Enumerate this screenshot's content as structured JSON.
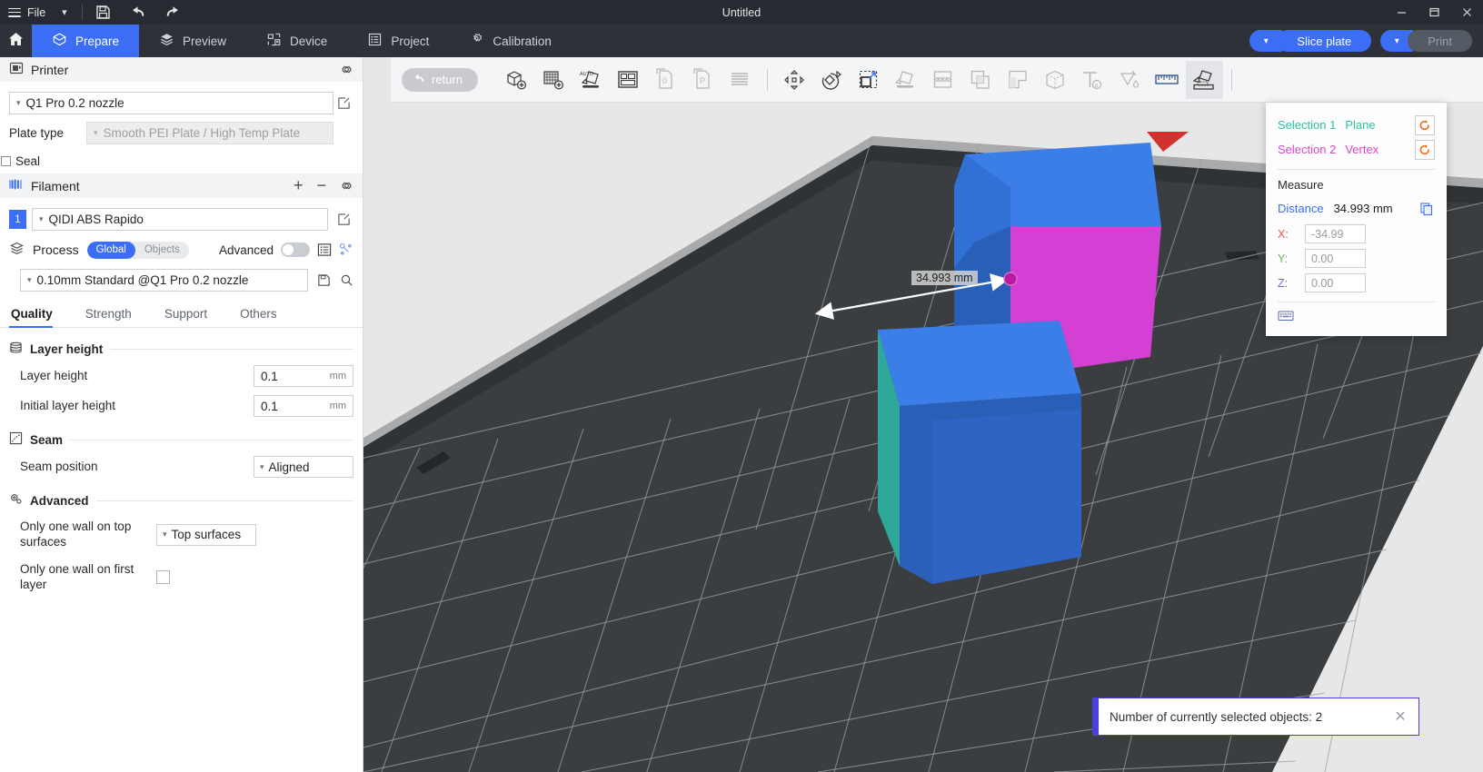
{
  "titlebar": {
    "menu_label": "File",
    "window_title": "Untitled",
    "icons": [
      "save-icon",
      "undo-icon",
      "redo-icon"
    ],
    "minimize": "–",
    "maximize": "❐",
    "close": "✕"
  },
  "nav": {
    "home_icon": "home-icon",
    "tabs": [
      {
        "label": "Prepare",
        "icon": "prepare-icon",
        "active": true
      },
      {
        "label": "Preview",
        "icon": "preview-icon",
        "active": false
      },
      {
        "label": "Device",
        "icon": "device-icon",
        "active": false
      },
      {
        "label": "Project",
        "icon": "project-icon",
        "active": false
      },
      {
        "label": "Calibration",
        "icon": "calibration-icon",
        "active": false
      }
    ],
    "slice_label": "Slice plate",
    "print_label": "Print"
  },
  "sidebar": {
    "printer": {
      "section_title": "Printer",
      "gear_icon": "gear-icon",
      "printer_value": "Q1 Pro 0.2 nozzle",
      "plate_type_label": "Plate type",
      "plate_type_value": "Smooth PEI Plate / High Temp Plate",
      "seal_label": "Seal",
      "seal_checked": false
    },
    "filament": {
      "section_title": "Filament",
      "add_label": "+",
      "remove_label": "−",
      "gear_icon": "gear-icon",
      "index": "1",
      "value": "QIDI ABS Rapido"
    },
    "process": {
      "section_title": "Process",
      "seg_global": "Global",
      "seg_objects": "Objects",
      "advanced_label": "Advanced",
      "advanced_on": false,
      "preset_value": "0.10mm Standard @Q1 Pro 0.2 nozzle",
      "tabs": [
        {
          "label": "Quality",
          "active": true
        },
        {
          "label": "Strength",
          "active": false
        },
        {
          "label": "Support",
          "active": false
        },
        {
          "label": "Others",
          "active": false
        }
      ],
      "groups": [
        {
          "title": "Layer height",
          "icon": "layers-icon",
          "fields": [
            {
              "label": "Layer height",
              "type": "input",
              "value": "0.1",
              "unit": "mm"
            },
            {
              "label": "Initial layer height",
              "type": "input",
              "value": "0.1",
              "unit": "mm"
            }
          ]
        },
        {
          "title": "Seam",
          "icon": "seam-icon",
          "fields": [
            {
              "label": "Seam position",
              "type": "select",
              "value": "Aligned",
              "unit": ""
            }
          ]
        },
        {
          "title": "Advanced",
          "icon": "advanced-gear-icon",
          "fields": [
            {
              "label": "Only one wall on top surfaces",
              "type": "select",
              "value": "Top surfaces",
              "unit": ""
            },
            {
              "label": "Only one wall on first layer",
              "type": "checkbox",
              "value": "",
              "unit": ""
            }
          ]
        }
      ]
    }
  },
  "viewport": {
    "return_label": "return",
    "tools": [
      {
        "name": "add-object-icon",
        "state": "enabled"
      },
      {
        "name": "add-plate-icon",
        "state": "enabled"
      },
      {
        "name": "auto-arrange-icon",
        "state": "enabled"
      },
      {
        "name": "auto-layout-icon",
        "state": "enabled"
      },
      {
        "name": "add-modifier-zero-icon",
        "state": "disabled"
      },
      {
        "name": "add-plate-p-icon",
        "state": "disabled"
      },
      {
        "name": "variable-layer-height-icon",
        "state": "disabled"
      },
      {
        "name": "move-icon",
        "state": "enabled"
      },
      {
        "name": "rotate-icon",
        "state": "enabled"
      },
      {
        "name": "scale-icon",
        "state": "enabled"
      },
      {
        "name": "place-on-face-icon",
        "state": "disabled"
      },
      {
        "name": "cut-icon",
        "state": "disabled"
      },
      {
        "name": "mesh-boolean-icon",
        "state": "disabled"
      },
      {
        "name": "support-painting-icon",
        "state": "disabled"
      },
      {
        "name": "seam-painting-icon",
        "state": "disabled"
      },
      {
        "name": "text-icon",
        "state": "disabled"
      },
      {
        "name": "color-painting-icon",
        "state": "disabled"
      },
      {
        "name": "measure-icon",
        "state": "enabled"
      },
      {
        "name": "assembly-icon",
        "state": "selected"
      }
    ],
    "measure_overlay_label": "34.993 mm"
  },
  "measure_panel": {
    "selection1_label": "Selection 1",
    "selection1_type": "Plane",
    "selection2_label": "Selection 2",
    "selection2_type": "Vertex",
    "reset_icon": "reset-icon",
    "measure_title": "Measure",
    "distance_label": "Distance",
    "distance_value": "34.993 mm",
    "copy_icon": "copy-icon",
    "axes": [
      {
        "key": "X:",
        "value": "-34.99"
      },
      {
        "key": "Y:",
        "value": "0.00"
      },
      {
        "key": "Z:",
        "value": "0.00"
      }
    ],
    "keyboard_icon": "keyboard-icon"
  },
  "toast": {
    "message": "Number of currently selected objects: 2",
    "close_icon": "close-icon"
  },
  "colors": {
    "accent": "#3b6ef5",
    "selection1": "#2cc2a5",
    "selection2": "#d946c8",
    "toast_accent": "#4b3fe0",
    "cube_top": "#3b7ee8",
    "cube_face_magenta": "#d43fd4",
    "cube_face_teal": "#2fa899",
    "plate": "#3a3e41"
  }
}
